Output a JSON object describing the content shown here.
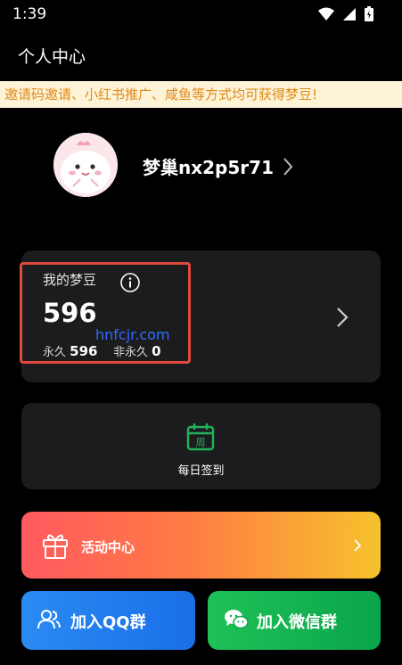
{
  "status_bar": {
    "time": "1:39",
    "icons": [
      "wifi-icon",
      "signal-icon",
      "battery-icon"
    ]
  },
  "header": {
    "title": "个人中心"
  },
  "notice": {
    "text": "邀请码邀请、小红书推广、咸鱼等方式均可获得梦豆!"
  },
  "profile": {
    "username": "梦巢nx2p5r71",
    "avatar": "avatar-image"
  },
  "beans": {
    "label": "我的梦豆",
    "total": "596",
    "permanent_label": "永久",
    "permanent_value": "596",
    "temporary_label": "非永久",
    "temporary_value": "0"
  },
  "watermark": "hnfcjr.com",
  "checkin": {
    "label": "每日签到",
    "calendar_text": "周"
  },
  "activity": {
    "label": "活动中心"
  },
  "groups": {
    "qq_label": "加入QQ群",
    "wechat_label": "加入微信群"
  },
  "colors": {
    "background": "#000000",
    "card": "#1c1c1e",
    "notice_bg": "#fdf3d7",
    "notice_text": "#e08a1a",
    "highlight_border": "#e04a3c",
    "checkin_green": "#21b25a",
    "qq_blue": "#1a6ee6",
    "wechat_green": "#0aa54a"
  }
}
